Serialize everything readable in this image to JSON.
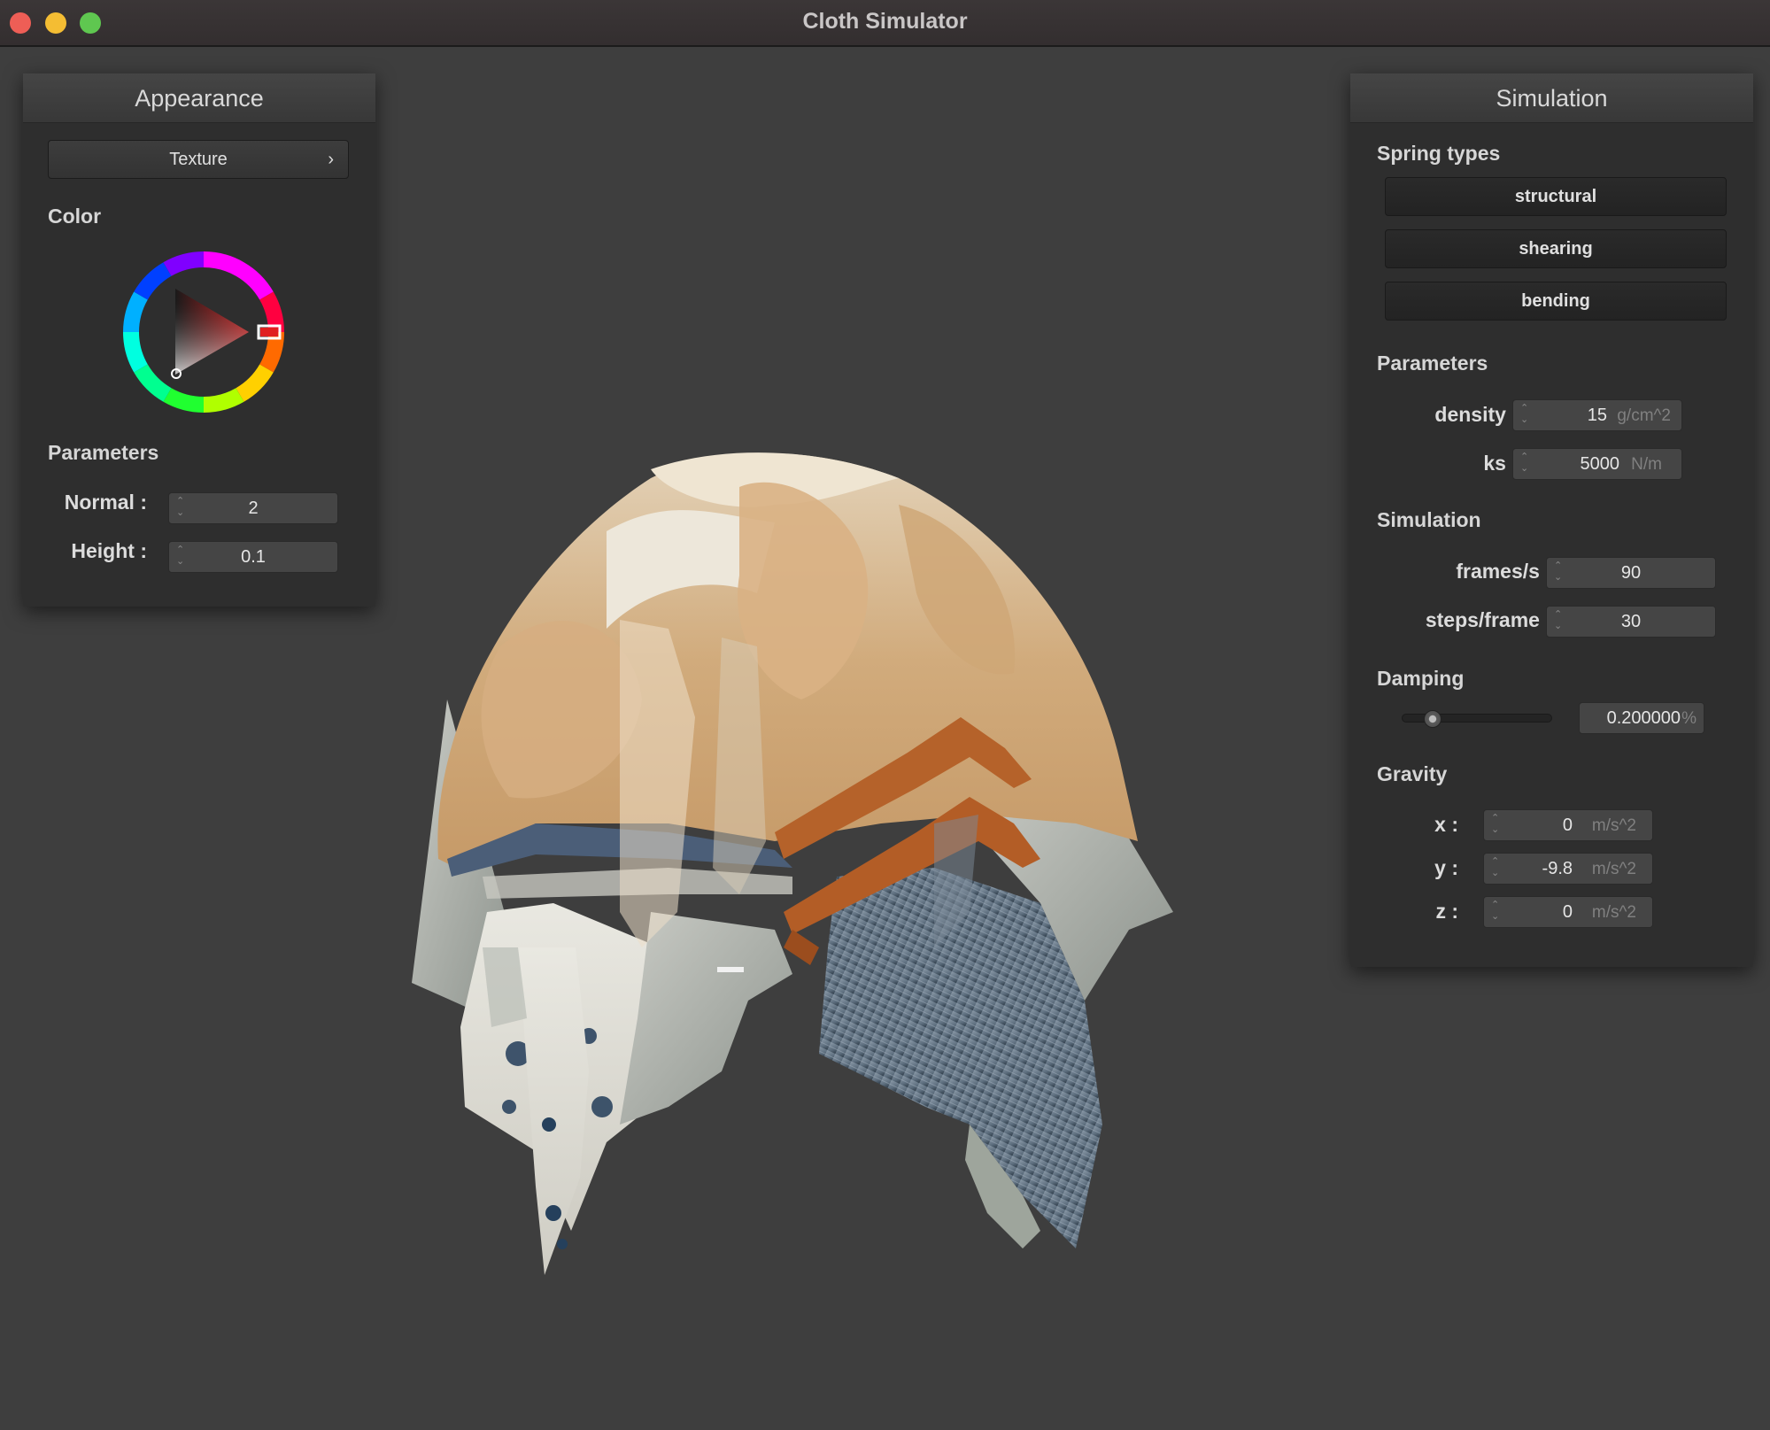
{
  "window": {
    "title": "Cloth Simulator"
  },
  "appearance": {
    "header": "Appearance",
    "texture_button": "Texture",
    "texture_chevron": "›",
    "color_section": "Color",
    "params_section": "Parameters",
    "normal_label": "Normal :",
    "normal_value": "2",
    "height_label": "Height :",
    "height_value": "0.1",
    "selected_color": "#e02020"
  },
  "simulation": {
    "header": "Simulation",
    "spring_types_section": "Spring types",
    "spring_buttons": [
      "structural",
      "shearing",
      "bending"
    ],
    "params_section": "Parameters",
    "density_label": "density :",
    "density_value": "15",
    "density_unit": "g/cm^2",
    "ks_label": "ks :",
    "ks_value": "5000",
    "ks_unit": "N/m",
    "sim_section": "Simulation",
    "fps_label": "frames/s :",
    "fps_value": "90",
    "steps_label": "steps/frame :",
    "steps_value": "30",
    "damping_section": "Damping",
    "damping_value": "0.200000",
    "damping_unit": "%",
    "damping_fraction": 0.2,
    "gravity_section": "Gravity",
    "gx_label": "x :",
    "gx_value": "0",
    "gy_label": "y :",
    "gy_value": "-9.8",
    "gz_label": "z :",
    "gz_value": "0",
    "gravity_unit": "m/s^2"
  }
}
